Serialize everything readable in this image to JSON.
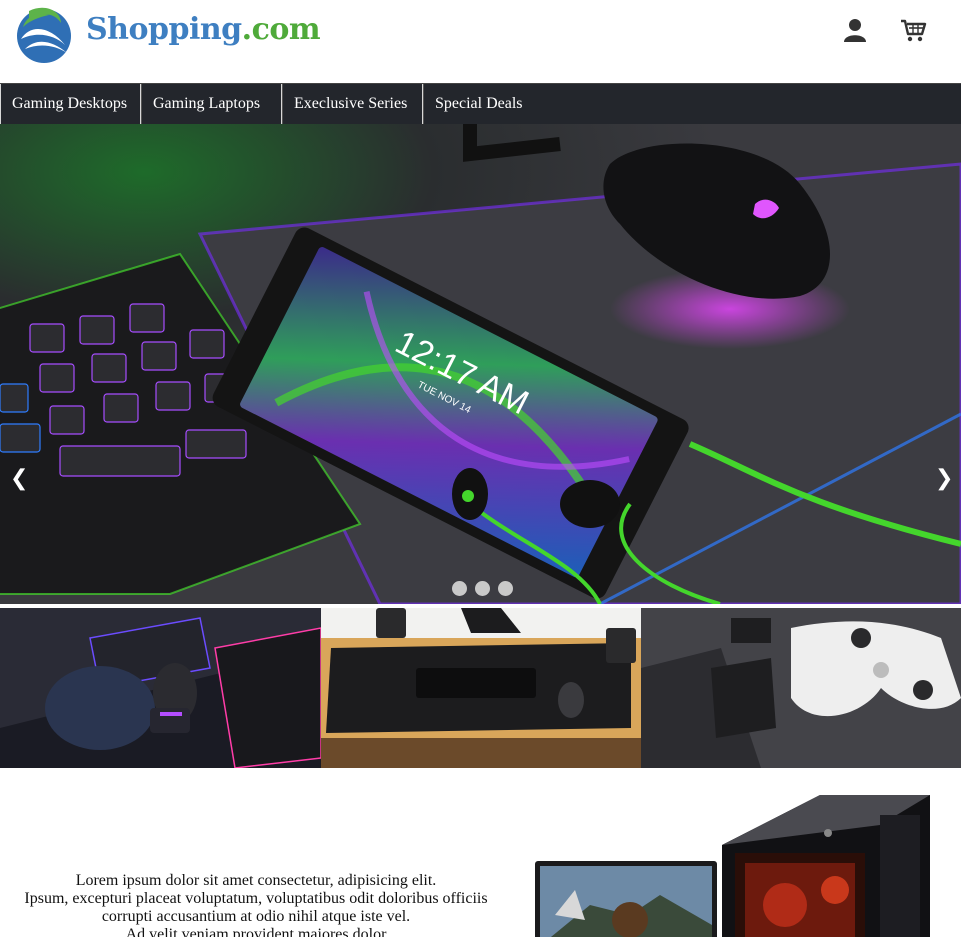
{
  "brand": {
    "part1": "Shopping",
    "part2": ".com"
  },
  "header": {
    "user_icon": "user-icon",
    "cart_icon": "cart-icon"
  },
  "nav": {
    "items": [
      {
        "label": "Gaming Desktops"
      },
      {
        "label": "Gaming Laptops"
      },
      {
        "label": "Execlusive Series"
      },
      {
        "label": "Special Deals"
      }
    ]
  },
  "carousel": {
    "prev_label": "❮",
    "next_label": "❯",
    "slide_count": 3,
    "active_index": 0,
    "phone_time": "12:17 AM",
    "phone_date": "TUE NOV 14"
  },
  "lower": {
    "lines": [
      "Lorem ipsum dolor sit amet consectetur, adipisicing elit.",
      "Ipsum, excepturi placeat voluptatum, voluptatibus odit doloribus officiis",
      "corrupti accusantium at odio nihil atque iste vel.",
      "Ad velit veniam provident maiores dolor"
    ]
  },
  "colors": {
    "brand_blue": "#3e7fc1",
    "brand_green": "#4faa3a",
    "nav_bg": "#23262c",
    "razer_green": "#44d62c"
  }
}
